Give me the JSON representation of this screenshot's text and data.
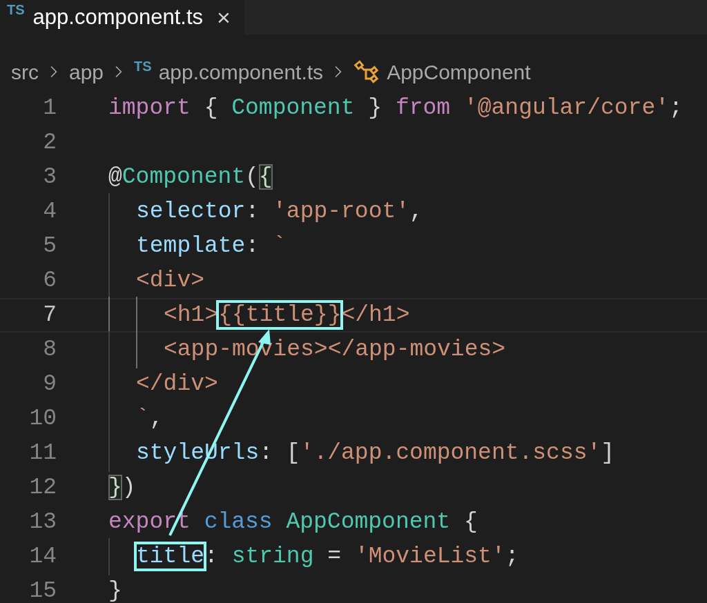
{
  "tab": {
    "label": "app.component.ts",
    "badge": "TS",
    "close": "×",
    "selected": true
  },
  "breadcrumbs": [
    {
      "label": "src",
      "kind": "folder"
    },
    {
      "label": "app",
      "kind": "folder"
    },
    {
      "label": "app.component.ts",
      "kind": "file",
      "badge": "TS"
    },
    {
      "label": "AppComponent",
      "kind": "symbol"
    }
  ],
  "lines": [
    {
      "number": "1",
      "current": false,
      "tokens": [
        {
          "text": "import",
          "kind": "keyword"
        },
        {
          "text": " { ",
          "kind": "plain"
        },
        {
          "text": "Component",
          "kind": "type"
        },
        {
          "text": " } ",
          "kind": "plain"
        },
        {
          "text": "from ",
          "kind": "keyword"
        },
        {
          "text": "'@angular/core'",
          "kind": "string"
        },
        {
          "text": ";",
          "kind": "plain"
        }
      ]
    },
    {
      "number": "2",
      "current": false
    },
    {
      "number": "3",
      "current": false,
      "tokens": [
        {
          "text": "@",
          "kind": "plain"
        },
        {
          "text": "Component",
          "kind": "type"
        },
        {
          "text": "(",
          "kind": "plain"
        },
        {
          "text": "{",
          "kind": "plain",
          "matched": true
        }
      ],
      "children": [
        {
          "number": "4",
          "current": false,
          "tokens": [
            {
              "text": "selector",
              "kind": "property"
            },
            {
              "text": ": ",
              "kind": "plain"
            },
            {
              "text": "'app-root'",
              "kind": "string"
            },
            {
              "text": ",",
              "kind": "plain"
            }
          ]
        },
        {
          "number": "5",
          "current": false,
          "tokens": [
            {
              "text": "template",
              "kind": "property"
            },
            {
              "text": ": ",
              "kind": "plain"
            },
            {
              "text": "`",
              "kind": "string"
            }
          ]
        },
        {
          "number": "6",
          "current": false,
          "tokens": [
            {
              "text": "<div>",
              "kind": "string"
            }
          ],
          "children": [
            {
              "number": "7",
              "current": true,
              "tokens": [
                {
                  "text": "<h1>",
                  "kind": "string"
                },
                {
                  "text": "{{title}}",
                  "kind": "string",
                  "highlighted": true
                },
                {
                  "text": "</h1>",
                  "kind": "string"
                }
              ]
            },
            {
              "number": "8",
              "current": false,
              "tokens": [
                {
                  "text": "<app-movies></app-movies>",
                  "kind": "string"
                }
              ]
            }
          ]
        },
        {
          "number": "9",
          "current": false,
          "tokens": [
            {
              "text": "</div>",
              "kind": "string"
            }
          ]
        },
        {
          "number": "10",
          "current": false,
          "tokens": [
            {
              "text": "`",
              "kind": "string"
            },
            {
              "text": ",",
              "kind": "plain"
            }
          ]
        },
        {
          "number": "11",
          "current": false,
          "tokens": [
            {
              "text": "styleUrls",
              "kind": "property"
            },
            {
              "text": ": [",
              "kind": "plain"
            },
            {
              "text": "'./app.component.scss'",
              "kind": "string"
            },
            {
              "text": "]",
              "kind": "plain"
            }
          ]
        }
      ]
    },
    {
      "number": "12",
      "current": false,
      "tokens": [
        {
          "text": "}",
          "kind": "plain",
          "matched": true
        },
        {
          "text": ")",
          "kind": "plain"
        }
      ]
    },
    {
      "number": "13",
      "current": false,
      "tokens": [
        {
          "text": "export ",
          "kind": "keyword"
        },
        {
          "text": "class ",
          "kind": "storage"
        },
        {
          "text": "AppComponent",
          "kind": "type"
        },
        {
          "text": " {",
          "kind": "plain"
        }
      ],
      "children": [
        {
          "number": "14",
          "current": false,
          "tokens": [
            {
              "text": "title",
              "kind": "property",
              "highlighted": true
            },
            {
              "text": ": ",
              "kind": "plain"
            },
            {
              "text": "string",
              "kind": "type"
            },
            {
              "text": " = ",
              "kind": "plain"
            },
            {
              "text": "'MovieList'",
              "kind": "string"
            },
            {
              "text": ";",
              "kind": "plain"
            }
          ]
        }
      ]
    },
    {
      "number": "15",
      "current": false,
      "tokens": [
        {
          "text": "}",
          "kind": "plain"
        }
      ]
    }
  ]
}
